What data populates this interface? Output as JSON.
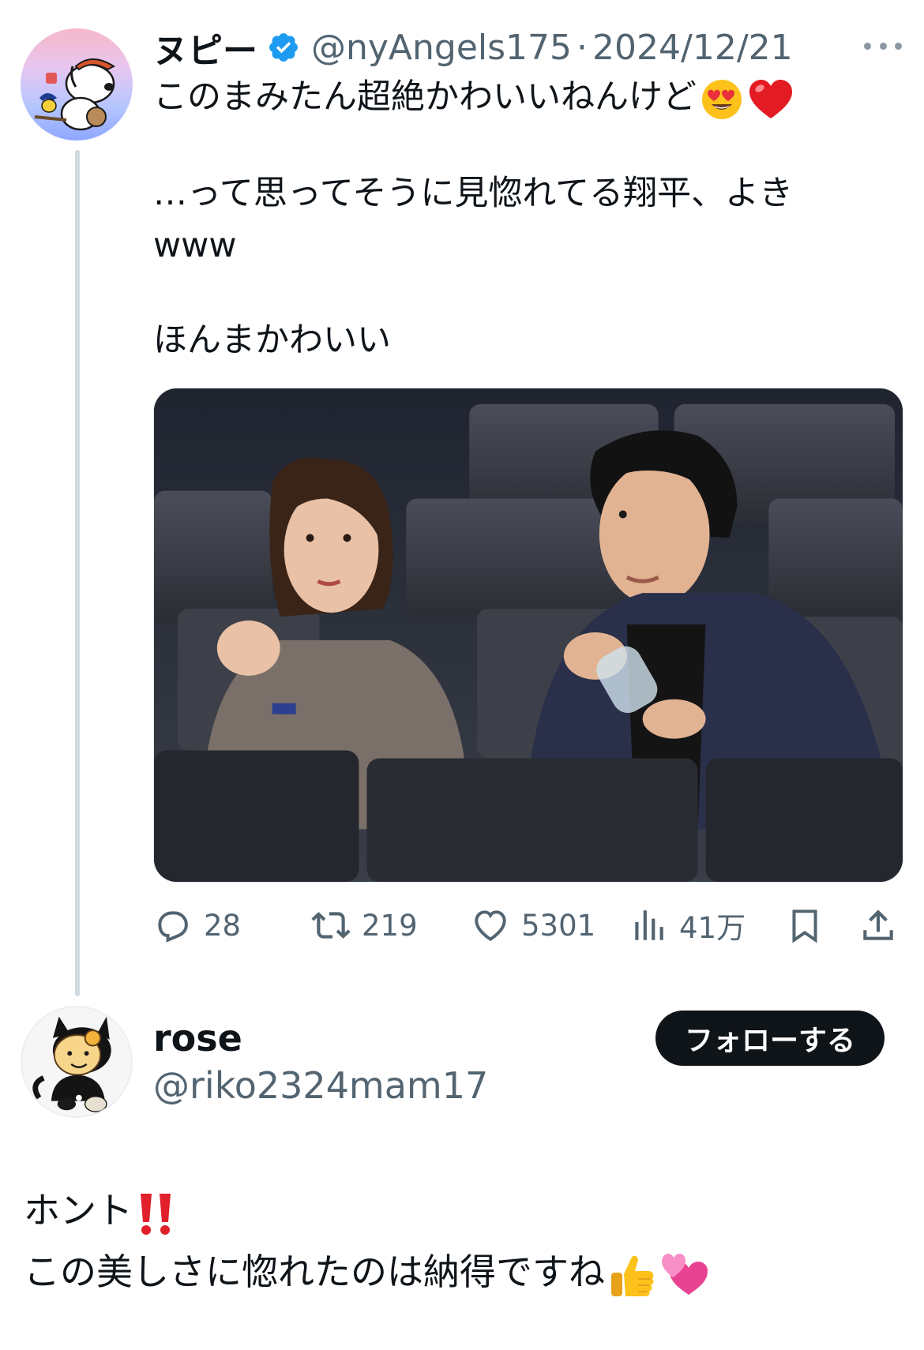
{
  "tweet": {
    "display_name": "ヌピー",
    "verified": true,
    "handle": "@nyAngels175",
    "separator": "·",
    "date": "2024/12/21",
    "text_line1": "このまみたん超絶かわいいねんけど",
    "text_line1_emojis": [
      "heart-eyes-emoji",
      "red-heart-emoji"
    ],
    "text_line2": "…って思ってそうに見惚れてる翔平、よき",
    "text_line3": "www",
    "text_line4": "ほんまかわいい"
  },
  "actions": {
    "replies": "28",
    "retweets": "219",
    "likes": "5301",
    "views": "41万"
  },
  "reply": {
    "display_name": "rose",
    "handle": "@riko2324mam17",
    "follow_label": "フォローする",
    "text_line1": "ホント",
    "text_line1_emojis": [
      "double-exclamation-emoji"
    ],
    "text_line2": "この美しさに惚れたのは納得ですね",
    "text_line2_emojis": [
      "thumbs-up-emoji",
      "revolving-hearts-emoji"
    ]
  },
  "colors": {
    "primary_text": "#0f1419",
    "secondary_text": "#536471",
    "verified_blue": "#1d9bf0",
    "thread_line": "#cfd9de",
    "follow_button_bg": "#0f1419"
  }
}
